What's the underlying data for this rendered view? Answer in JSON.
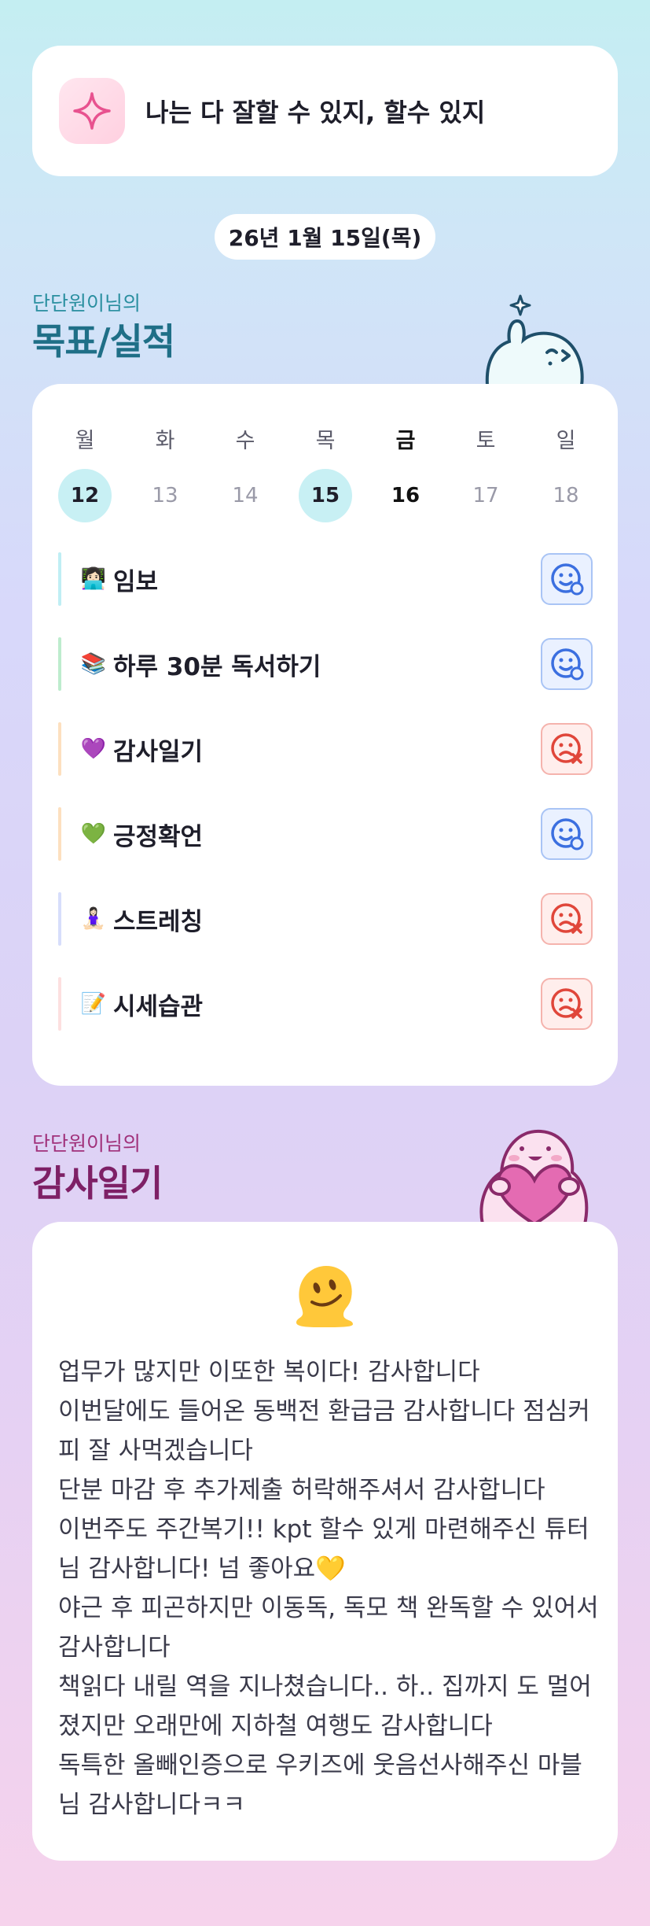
{
  "affirmation": {
    "icon": "sparkle-icon",
    "text": "나는 다 잘할 수 있지, 할수 있지"
  },
  "date_label": "26년 1월 15일(목)",
  "goals_section": {
    "subtitle": "단단원이님의",
    "title": "목표/실적"
  },
  "week": {
    "days": [
      {
        "label": "월",
        "date": "12",
        "state": "done"
      },
      {
        "label": "화",
        "date": "13",
        "state": "normal"
      },
      {
        "label": "수",
        "date": "14",
        "state": "normal"
      },
      {
        "label": "목",
        "date": "15",
        "state": "done"
      },
      {
        "label": "금",
        "date": "16",
        "state": "today"
      },
      {
        "label": "토",
        "date": "17",
        "state": "normal"
      },
      {
        "label": "일",
        "date": "18",
        "state": "normal"
      }
    ]
  },
  "goals": [
    {
      "icon": "person-at-laptop-icon",
      "emoji": "👩🏻‍💻",
      "name": "임보",
      "status": "success",
      "bar_color": "#bfeef4"
    },
    {
      "icon": "books-icon",
      "emoji": "📚",
      "name": "하루 30분 독서하기",
      "status": "success",
      "bar_color": "#bdeccd"
    },
    {
      "icon": "purple-heart-icon",
      "emoji": "💜",
      "name": "감사일기",
      "status": "fail",
      "bar_color": "#fde0bf"
    },
    {
      "icon": "green-heart-icon",
      "emoji": "💚",
      "name": "긍정확언",
      "status": "success",
      "bar_color": "#fde0bf"
    },
    {
      "icon": "person-stretching-icon",
      "emoji": "🧘🏻‍♀️",
      "name": "스트레칭",
      "status": "fail",
      "bar_color": "#d7defb"
    },
    {
      "icon": "memo-icon",
      "emoji": "📝",
      "name": "시세습관",
      "status": "fail",
      "bar_color": "#fde0e0"
    }
  ],
  "diary_section": {
    "subtitle": "단단원이님의",
    "title": "감사일기",
    "emoji": "melting-face-icon",
    "lines": [
      "업무가 많지만 이또한 복이다! 감사합니다",
      "이번달에도 들어온 동백전 환급금 감사합니다 점심커",
      "피 잘 사먹겠습니다",
      "단분 마감 후 추가제출 허락해주셔서 감사합니다",
      "이번주도 주간복기!! kpt 할수 있게 마련해주신 튜터",
      "님 감사합니다! 넘 좋아요💛",
      "야근 후 피곤하지만 이동독, 독모 책 완독할 수 있어서",
      "감사합니다",
      "책읽다 내릴 역을 지나쳤습니다.. 하.. 집까지 도 멀어",
      "졌지만 오래만에 지하철 여행도 감사합니다",
      "독특한 올빼인증으로 우키즈에 웃음선사해주신 마블",
      "님 감사합니다ㅋㅋ"
    ]
  },
  "colors": {
    "accent_teal": "#1f6f87",
    "accent_purple": "#7e2066",
    "success_blue": "#3b6fe0",
    "fail_red": "#e0463a"
  }
}
